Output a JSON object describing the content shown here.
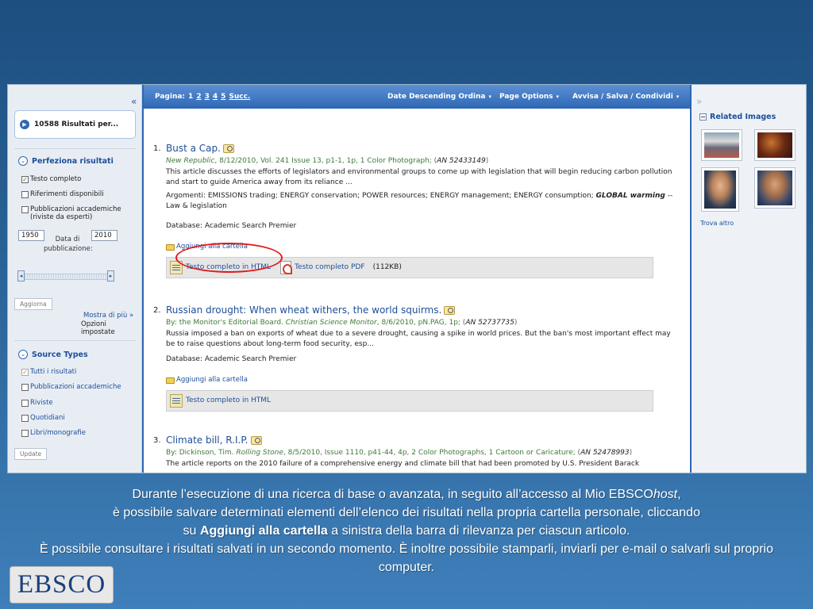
{
  "sidebar": {
    "collapse_glyph": "«",
    "results_count_label": "10588 Risultati per...",
    "refine_title": "Perfeziona risultati",
    "refine_options": [
      {
        "label": "Testo completo",
        "checked": true
      },
      {
        "label": "Riferimenti disponibili",
        "checked": false
      },
      {
        "label": "Pubblicazioni accademiche (riviste da esperti)",
        "checked": false
      }
    ],
    "year_from": "1950",
    "year_to": "2010",
    "date_label": "Data di pubblicazione:",
    "update_button": "Aggiorna",
    "show_more": "Mostra di più »",
    "options_set": "Opzioni impostate",
    "source_types_title": "Source Types",
    "source_types": [
      {
        "label": "Tutti i risultati",
        "checked": true
      },
      {
        "label": "Pubblicazioni accademiche",
        "checked": false
      },
      {
        "label": "Riviste",
        "checked": false
      },
      {
        "label": "Quotidiani",
        "checked": false
      },
      {
        "label": "Libri/monografie",
        "checked": false
      }
    ],
    "source_update_button": "Update"
  },
  "toolbar": {
    "page_label": "Pagina:",
    "pages": [
      "1",
      "2",
      "3",
      "4",
      "5"
    ],
    "next": "Succ.",
    "sort": "Date Descending Ordina",
    "page_options": "Page Options",
    "alert_save_share": "Avvisa / Salva / Condividi"
  },
  "results": [
    {
      "number": "1.",
      "title": "Bust a Cap.",
      "source_pub": "New Republic",
      "source_rest": ", 8/12/2010, Vol. 241 Issue 13, p1-1, 1p, 1 Color Photograph; (",
      "an": "AN 52433149",
      "source_close": ")",
      "description": "This article discusses the efforts of legislators and environmental groups to come up with legislation that will begin reducing carbon pollution and start to guide America away from its reliance ...",
      "subjects_prefix": "Argomenti: EMISSIONS trading; ENERGY conservation; POWER resources; ENERGY management; ENERGY consumption; ",
      "subjects_bold": "GLOBAL warming",
      "subjects_suffix": " -- Law & legislation",
      "database": "Database: Academic Search Premier",
      "add_folder": "Aggiungi alla cartella",
      "html_link": "Testo completo in HTML",
      "pdf_link": "Testo completo PDF",
      "pdf_size": "(112KB)"
    },
    {
      "number": "2.",
      "title": "Russian drought: When wheat withers, the world squirms.",
      "byline": "By: the Monitor's Editorial Board. ",
      "source_pub": "Christian Science Monitor",
      "source_rest": ", 8/6/2010, pN.PAG, 1p; (",
      "an": "AN 52737735",
      "source_close": ")",
      "description": "Russia imposed a ban on exports of wheat due to a severe drought, causing a spike in world prices. But the ban's most important effect may be to raise questions about long-term food security, esp...",
      "database": "Database: Academic Search Premier",
      "add_folder": "Aggiungi alla cartella",
      "html_link": "Testo completo in HTML"
    },
    {
      "number": "3.",
      "title": "Climate bill, R.I.P.",
      "byline": "By: Dickinson, Tim. ",
      "source_pub": "Rolling Stone",
      "source_rest": ", 8/5/2010, Issue 1110, p41-44, 4p, 2 Color Photographs, 1 Cartoon or Caricature; (",
      "an": "AN 52478993",
      "source_close": ")",
      "description": "The article reports on the 2010 failure of a comprehensive energy and climate bill that had been promoted by U.S. President Barack"
    }
  ],
  "right_panel": {
    "expand_glyph": "»",
    "related_title": "Related Images",
    "more_link": "Trova altro"
  },
  "caption": {
    "line1_pre": "Durante l’esecuzione di una ricerca di base o avanzata, in seguito all’accesso al Mio EBSCO",
    "line1_italic": "host",
    "line1_post": ",",
    "line2": "è possibile salvare determinati elementi dell’elenco dei risultati nella propria cartella personale, cliccando",
    "line3_pre": "su ",
    "line3_bold": "Aggiungi alla cartella",
    "line3_post": " a sinistra della barra di rilevanza per ciascun articolo.",
    "line4": "È possibile consultare i risultati salvati in un secondo momento. È inoltre possibile stamparli, inviarli per e-mail o salvarli sul proprio computer."
  },
  "logo": "EBSCO",
  "colors": {
    "accent_blue": "#2e67b4",
    "link_blue": "#1c4f99",
    "source_green": "#3f7a3a",
    "highlight_red": "#e21a1a"
  }
}
